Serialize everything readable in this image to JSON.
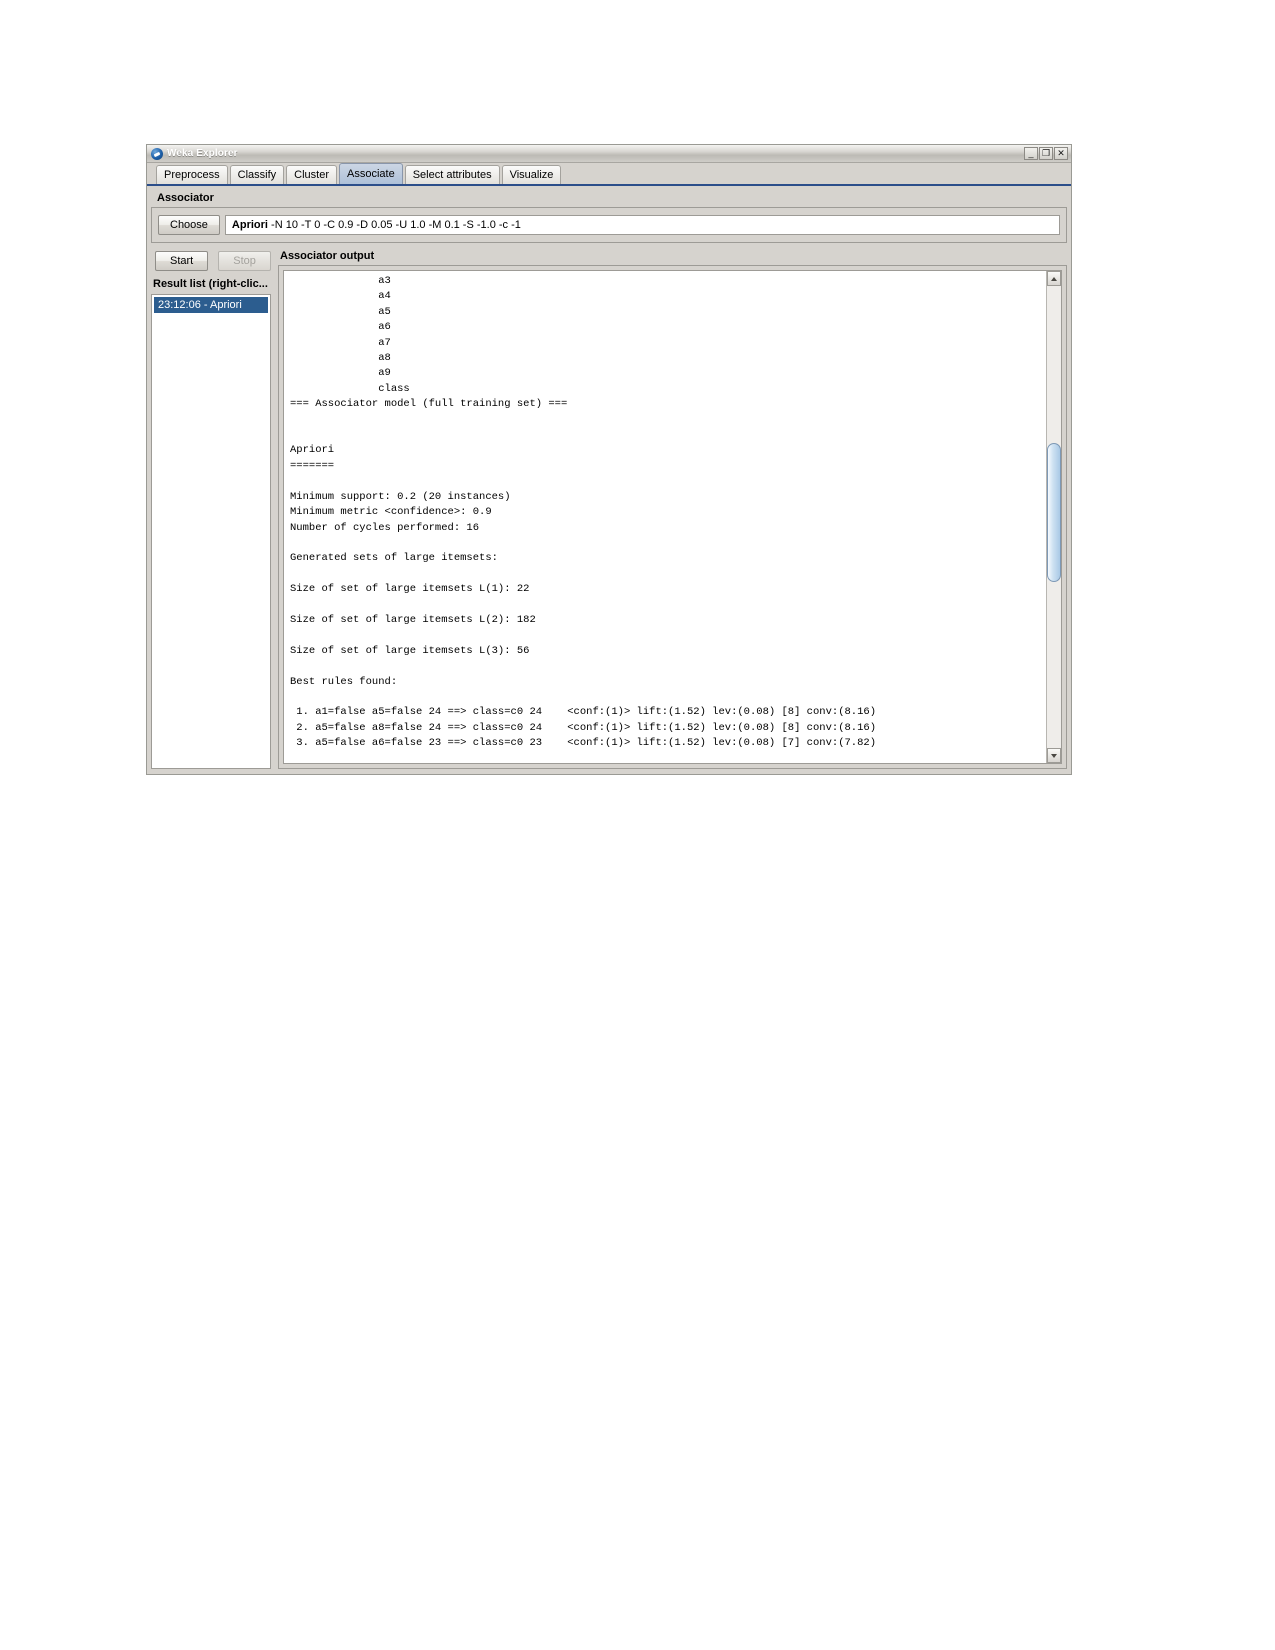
{
  "window": {
    "title": "Weka Explorer",
    "logo_icon": "weka-bird-icon",
    "controls": [
      {
        "name": "minimize-button",
        "glyph": "_"
      },
      {
        "name": "maximize-button",
        "glyph": "❐"
      },
      {
        "name": "close-button",
        "glyph": "✕"
      }
    ]
  },
  "tabs": [
    {
      "label": "Preprocess",
      "selected": false
    },
    {
      "label": "Classify",
      "selected": false
    },
    {
      "label": "Cluster",
      "selected": false
    },
    {
      "label": "Associate",
      "selected": true
    },
    {
      "label": "Select attributes",
      "selected": false
    },
    {
      "label": "Visualize",
      "selected": false
    }
  ],
  "associator": {
    "section_label": "Associator",
    "choose_button": "Choose",
    "scheme_name": "Apriori",
    "scheme_args": "-N 10 -T 0 -C 0.9 -D 0.05 -U 1.0 -M 0.1 -S -1.0 -c -1"
  },
  "run": {
    "start_label": "Start",
    "stop_label": "Stop",
    "stop_enabled": false
  },
  "result_list": {
    "label": "Result list (right-clic...",
    "items": [
      {
        "label": "23:12:06 - Apriori",
        "selected": true
      }
    ]
  },
  "output": {
    "label": "Associator output",
    "text": "              a3\n              a4\n              a5\n              a6\n              a7\n              a8\n              a9\n              class\n=== Associator model (full training set) ===\n\n\nApriori\n=======\n\nMinimum support: 0.2 (20 instances)\nMinimum metric <confidence>: 0.9\nNumber of cycles performed: 16\n\nGenerated sets of large itemsets:\n\nSize of set of large itemsets L(1): 22\n\nSize of set of large itemsets L(2): 182\n\nSize of set of large itemsets L(3): 56\n\nBest rules found:\n\n 1. a1=false a5=false 24 ==> class=c0 24    <conf:(1)> lift:(1.52) lev:(0.08) [8] conv:(8.16)\n 2. a5=false a8=false 24 ==> class=c0 24    <conf:(1)> lift:(1.52) lev:(0.08) [8] conv:(8.16)\n 3. a5=false a6=false 23 ==> class=c0 23    <conf:(1)> lift:(1.52) lev:(0.08) [7] conv:(7.82)"
  },
  "colors": {
    "selection_blue": "#2c5d8f",
    "tab_underline": "#2c4e8a",
    "panel_gray": "#d6d3ce"
  }
}
